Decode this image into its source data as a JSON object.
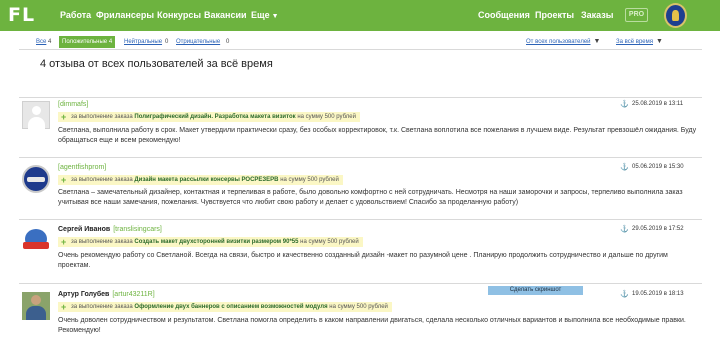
{
  "header": {
    "logo": "FL",
    "nav_left": [
      {
        "label": "Работа"
      },
      {
        "label": "Фрилансеры"
      },
      {
        "label": "Конкурсы"
      },
      {
        "label": "Вакансии"
      },
      {
        "label": "Еще"
      }
    ],
    "nav_right": [
      {
        "label": "Сообщения"
      },
      {
        "label": "Проекты"
      },
      {
        "label": "Заказы"
      }
    ],
    "pro_badge": "PRO"
  },
  "filters": {
    "all": {
      "label": "Все",
      "count": "4"
    },
    "positive": {
      "label": "Положительные",
      "count": "4"
    },
    "neutral": {
      "label": "Нейтральные",
      "count": "0"
    },
    "negative": {
      "label": "Отрицательные",
      "count": "0"
    },
    "from_dropdown": "От всех пользователей",
    "period_dropdown": "За всё время"
  },
  "page_title": "4 отзыва от всех пользователей за всё время",
  "reviews": [
    {
      "name": "",
      "login": "[dimmafs]",
      "date": "25.08.2019 в 13:11",
      "tag_prefix": "за выполнение заказа",
      "job": "Полиграфический дизайн. Разработка макета визиток",
      "tag_suffix": "на сумму 500 рублей",
      "text": "Светлана, выполнила работу в срок. Макет утвердили практически сразу, без особых корректировок, т.к. Светлана воплотила все пожелания в лучшем виде. Результат превзошёл ожидания. Буду обращаться еще и всем рекомендую!"
    },
    {
      "name": "",
      "login": "[agentfishprom]",
      "date": "05.06.2019 в 15:30",
      "tag_prefix": "за выполнение заказа",
      "job": "Дизайн макета рассылки консервы РОСРЕЗЕРВ",
      "tag_suffix": "на сумму 500 рублей",
      "text": "Светлана – замечательный дизайнер, контактная и терпеливая в работе, было довольно комфортно с ней сотрудничать. Несмотря на наши заморочки и запросы, терпеливо выполнила заказ учитывая все наши замечания, пожелания. Чувствуется что любит свою работу и делает с удовольствием! Спасибо за проделанную работу)"
    },
    {
      "name": "Сергей Иванов",
      "login": "[translisingcars]",
      "date": "29.05.2019 в 17:52",
      "tag_prefix": "за выполнение заказа",
      "job": "Создать макет двухсторонней визитки размером 90*55",
      "tag_suffix": "на сумму 500 рублей",
      "text": "Очень рекомендую работу со Светланой. Всегда на связи, быстро и качественно созданный дизайн -макет  по  разумной цене . Планирую продолжить сотрудничество и дальше по другим проектам."
    },
    {
      "name": "Артур Голубев",
      "login": "[artur43211R]",
      "date": "19.05.2019 в 18:13",
      "tag_prefix": "за выполнение заказа",
      "job": "Оформление двух баннеров с описанием возможностей модуля",
      "tag_suffix": "на сумму 500 рублей",
      "text": "Очень доволен сотрудничеством и результатом. Светлана помогла определить в каком направлении двигаться, сделала несколько отличных вариантов и выполнила все необходимые правки. Рекомендую!"
    }
  ],
  "screenshot_button": "Сделать скриншот",
  "colors": {
    "brand_green": "#6db33f",
    "link_blue": "#2b62b6",
    "tag_bg": "#fbf7c5"
  }
}
